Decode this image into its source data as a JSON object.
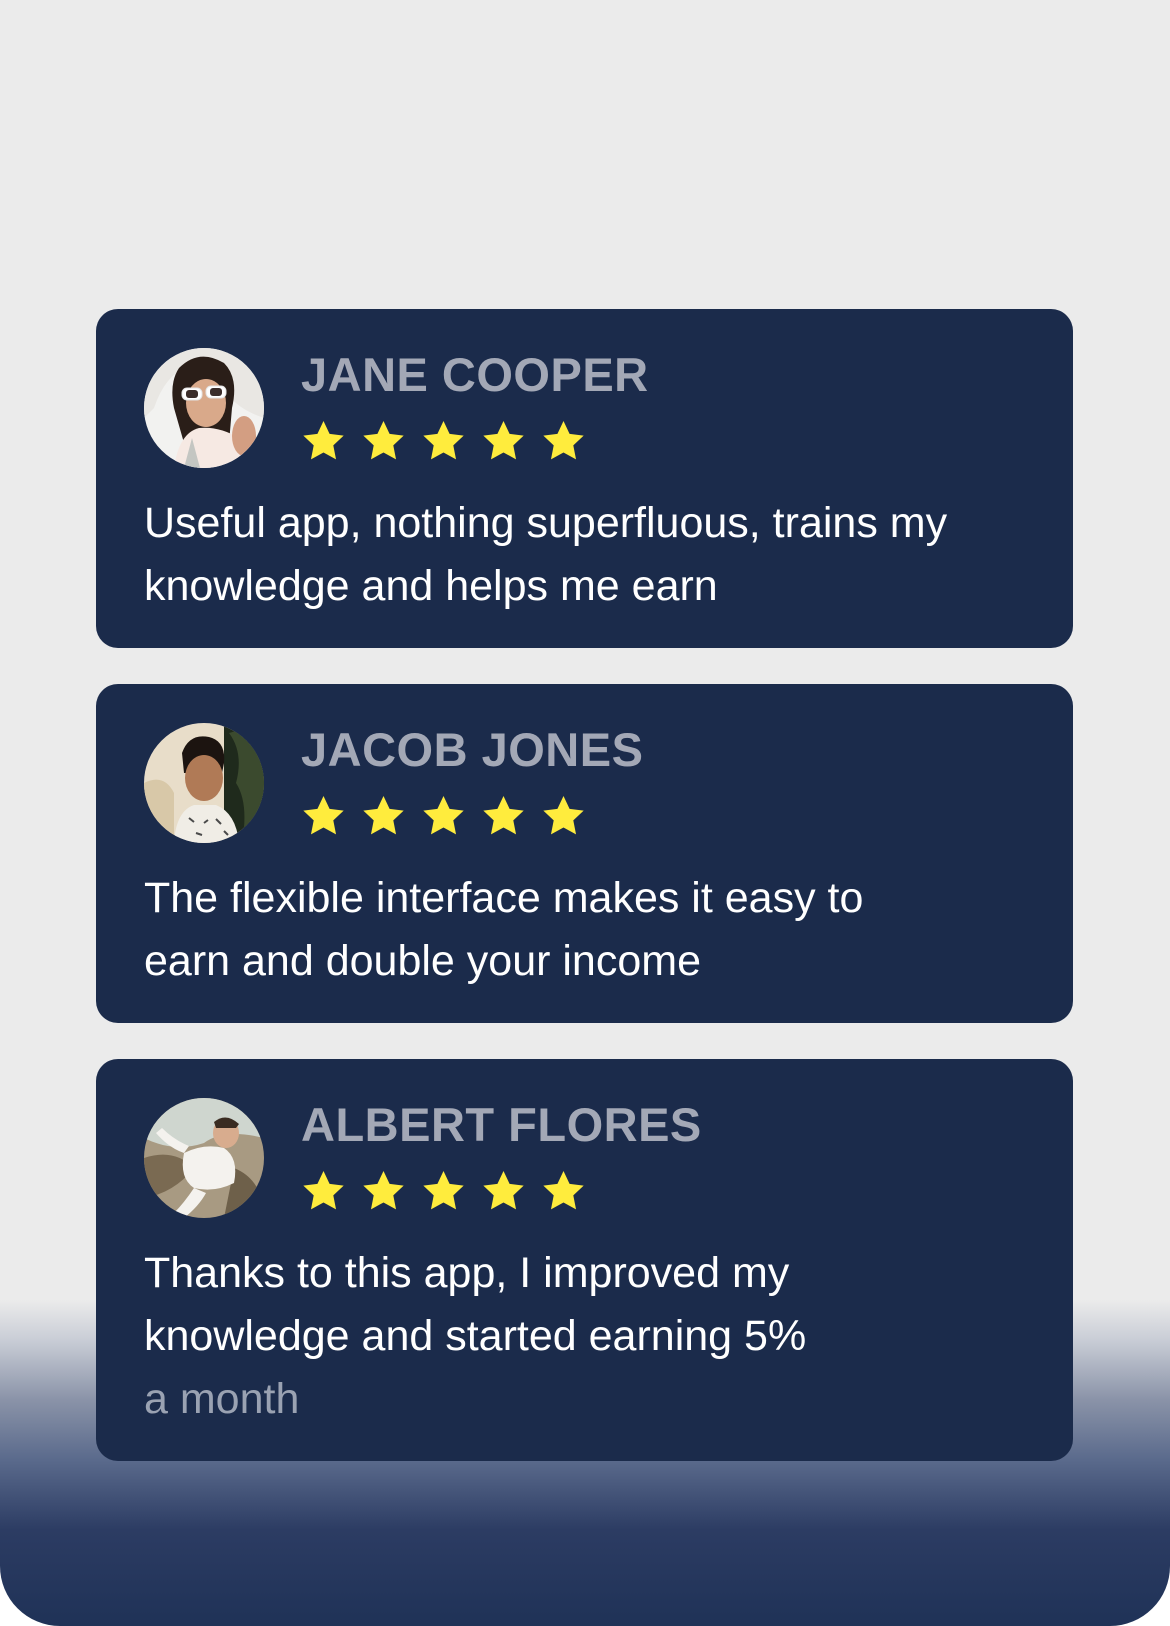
{
  "reviews": [
    {
      "name": "JANE COOPER",
      "rating": 5,
      "rating_max": 5,
      "avatar": "photo-woman-sunglasses-avatar",
      "text_lines": [
        "Useful app, nothing superfluous, trains my",
        "knowledge and helps me earn"
      ]
    },
    {
      "name": "JACOB JONES",
      "rating": 5,
      "rating_max": 5,
      "avatar": "photo-man-avatar",
      "text_lines": [
        "The flexible interface makes it easy to",
        "earn and double your income"
      ]
    },
    {
      "name": "ALBERT FLORES",
      "rating": 5,
      "rating_max": 5,
      "avatar": "photo-man-white-shirt-avatar",
      "text_lines": [
        "Thanks to this app, I improved my",
        "knowledge and started earning 5%",
        "a month"
      ]
    }
  ],
  "colors": {
    "background": "#ebebeb",
    "card": "#1b2b4b",
    "name_text": "#a3a8b6",
    "review_text": "#ffffff",
    "star": "#ffec3d",
    "bottom_gradient": "#1f3257"
  },
  "icons": {
    "star": "star-icon"
  }
}
